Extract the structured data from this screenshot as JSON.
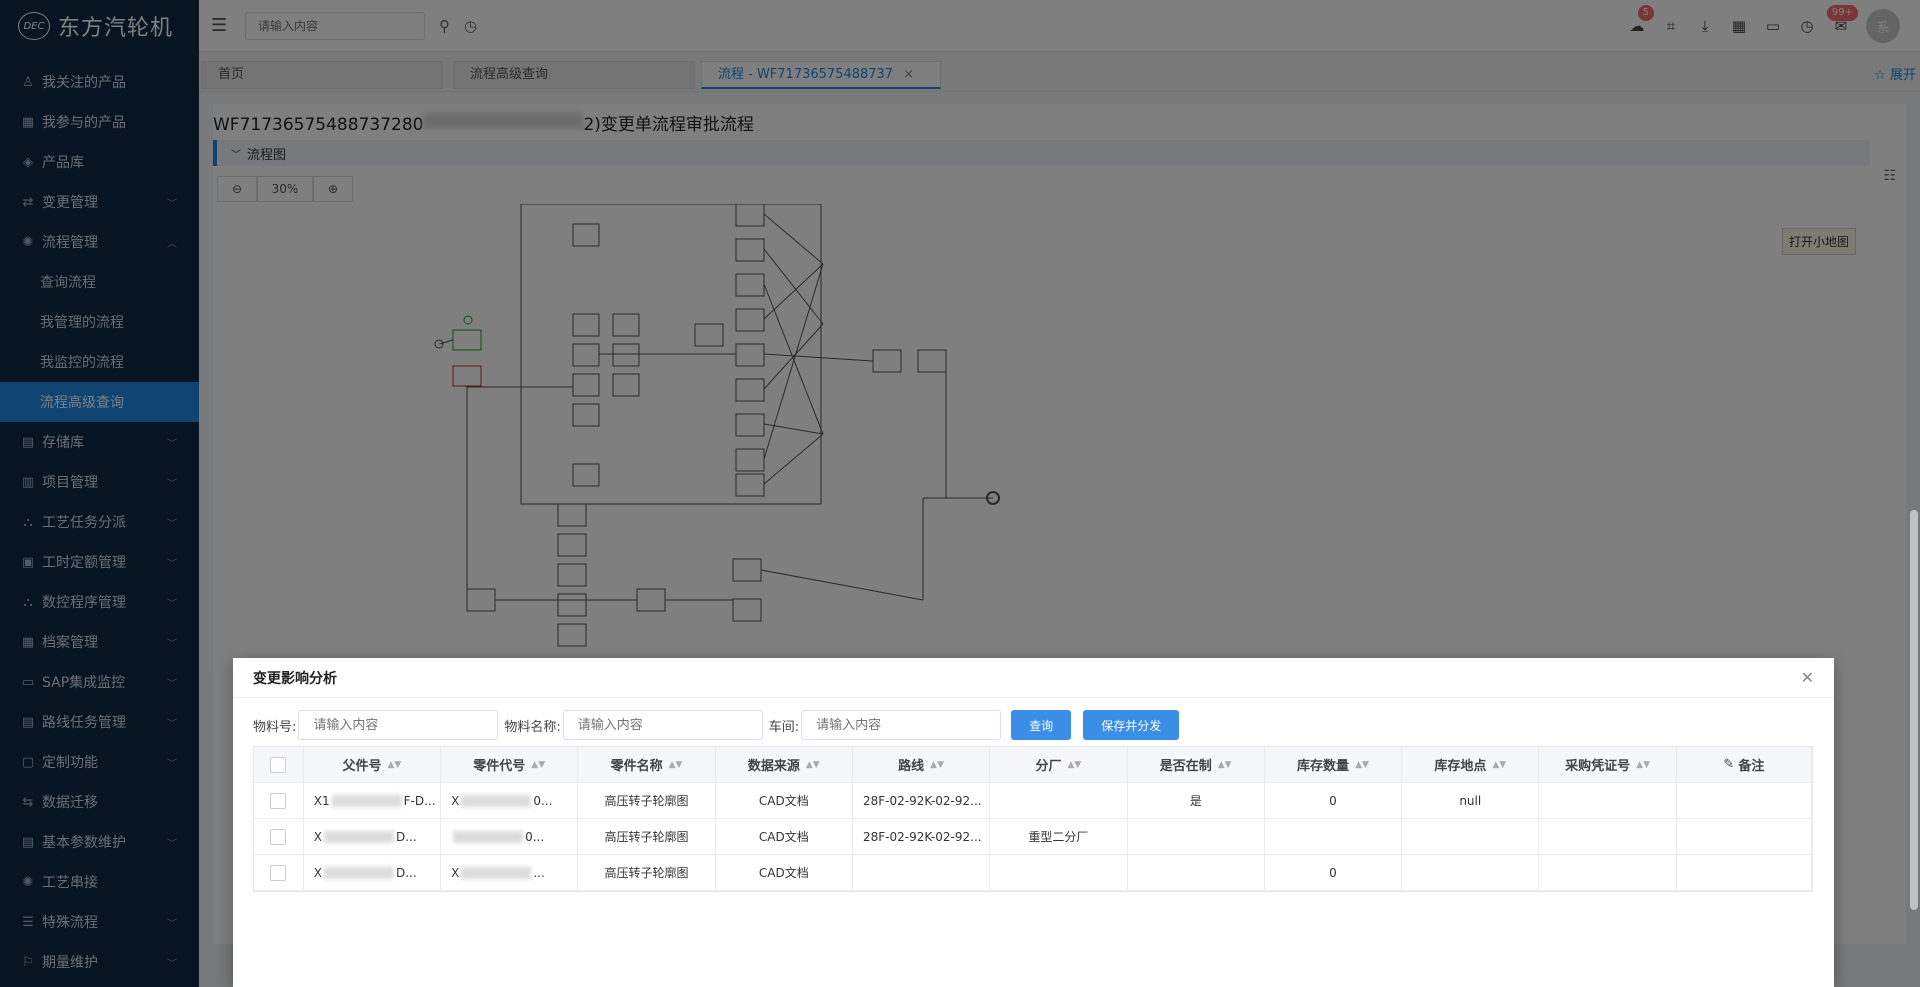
{
  "brand": {
    "logo_text": "DEC",
    "name": "东方汽轮机"
  },
  "sidebar": {
    "items": [
      {
        "label": "我关注的产品",
        "icon": "user-icon"
      },
      {
        "label": "我参与的产品",
        "icon": "grid-icon"
      },
      {
        "label": "产品库",
        "icon": "cube-icon"
      },
      {
        "label": "变更管理",
        "icon": "exchange-icon",
        "chevron": "down"
      },
      {
        "label": "流程管理",
        "icon": "process-icon",
        "chevron": "up"
      }
    ],
    "submenu": [
      {
        "label": "查询流程"
      },
      {
        "label": "我管理的流程"
      },
      {
        "label": "我监控的流程"
      },
      {
        "label": "流程高级查询",
        "active": true
      }
    ],
    "items_after": [
      {
        "label": "存储库",
        "icon": "database-icon"
      },
      {
        "label": "项目管理",
        "icon": "project-icon"
      },
      {
        "label": "工艺任务分派",
        "icon": "tree-icon"
      },
      {
        "label": "工时定额管理",
        "icon": "clock-icon"
      },
      {
        "label": "数控程序管理",
        "icon": "org-icon"
      },
      {
        "label": "档案管理",
        "icon": "archive-icon"
      },
      {
        "label": "SAP集成监控",
        "icon": "monitor-icon"
      },
      {
        "label": "路线任务管理",
        "icon": "route-icon"
      },
      {
        "label": "定制功能",
        "icon": "custom-icon"
      },
      {
        "label": "数据迁移",
        "icon": "migrate-icon"
      },
      {
        "label": "基本参数维护",
        "icon": "param-icon"
      },
      {
        "label": "工艺串接",
        "icon": "link-icon"
      },
      {
        "label": "特殊流程",
        "icon": "special-icon"
      },
      {
        "label": "期量维护",
        "icon": "period-icon"
      }
    ]
  },
  "topbar": {
    "search_placeholder": "请输入内容",
    "cloud_badge": "5",
    "message_badge": "99+",
    "avatar_text": "系"
  },
  "tabs": [
    {
      "label": "首页"
    },
    {
      "label": "流程高级查询"
    },
    {
      "label": "流程 - WF71736575488737",
      "active": true
    }
  ],
  "expand_label": "展开",
  "main": {
    "title_prefix": "WF71736575488737280",
    "title_suffix": "2)变更单流程审批流程",
    "section": "流程图",
    "zoom_value": "30%",
    "minimap_button": "打开小地图"
  },
  "dialog": {
    "title": "变更影响分析",
    "filters": [
      {
        "label": "物料号:",
        "placeholder": "请输入内容"
      },
      {
        "label": "物料名称:",
        "placeholder": "请输入内容"
      },
      {
        "label": "车间:",
        "placeholder": "请输入内容"
      }
    ],
    "query_button": "查询",
    "save_button": "保存并分发",
    "columns": [
      "父件号",
      "零件代号",
      "零件名称",
      "数据来源",
      "路线",
      "分厂",
      "是否在制",
      "库存数量",
      "库存地点",
      "采购凭证号",
      "备注"
    ],
    "rows": [
      {
        "parent_a": "X1",
        "parent_b": "F-D...",
        "part_a": "X",
        "part_b": "0...",
        "name": "高压转子轮廓图",
        "source": "CAD文档",
        "route": "28F-02-92K-02-92...",
        "factory": "",
        "in_process": "是",
        "qty": "0",
        "location": "null",
        "po": "",
        "remark": ""
      },
      {
        "parent_a": "X",
        "parent_b": "D...",
        "part_a": "",
        "part_b": "0...",
        "name": "高压转子轮廓图",
        "source": "CAD文档",
        "route": "28F-02-92K-02-92...",
        "factory": "重型二分厂",
        "in_process": "",
        "qty": "",
        "location": "",
        "po": "",
        "remark": ""
      },
      {
        "parent_a": "X",
        "parent_b": "D...",
        "part_a": "X",
        "part_b": "...",
        "name": "高压转子轮廓图",
        "source": "CAD文档",
        "route": "",
        "factory": "",
        "in_process": "",
        "qty": "0",
        "location": "",
        "po": "",
        "remark": ""
      }
    ]
  }
}
